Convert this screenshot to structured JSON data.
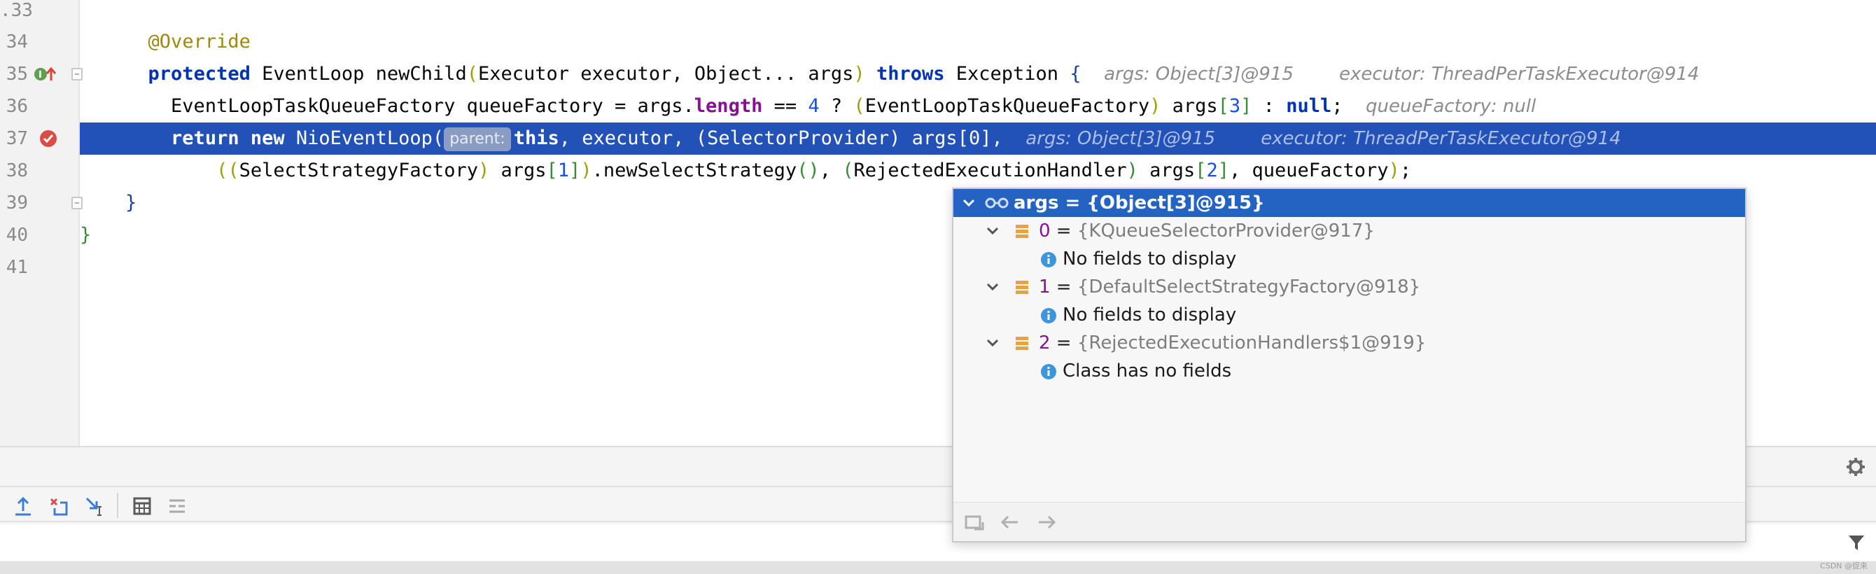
{
  "gutter": {
    "line_numbers": [
      ".33",
      "34",
      "35",
      "36",
      "37",
      "38",
      "39",
      "40",
      "41"
    ]
  },
  "code": {
    "line34": {
      "annotation": "@Override"
    },
    "line35": {
      "protected_kw": "protected",
      "ret_type": " EventLoop newChild",
      "lp": "(",
      "params_a": "Executor executor, Object... args",
      "rp": ")",
      "space": " ",
      "throws_kw": "throws",
      "rest": " Exception ",
      "brace": "{",
      "hint1": "args: Object[3]@915",
      "hint2": "executor: ThreadPerTaskExecutor@914"
    },
    "line36": {
      "a": "EventLoopTaskQueueFactory queueFactory = args.",
      "field": "length",
      "b": " == ",
      "num": "4",
      "c": " ? ",
      "lp": "(",
      "d": "EventLoopTaskQueueFactory",
      "rp": ")",
      "e": " args",
      "lb": "[",
      "idx": "3",
      "rb": "]",
      "f": " : ",
      "null_kw": "null",
      "g": ";",
      "hint": "queueFactory: null"
    },
    "line37": {
      "return_kw": "return new",
      "call": " NioEventLoop(",
      "param_badge": "parent:",
      "this_kw": "this",
      "rest": ", executor, (SelectorProvider) args[0],",
      "hint1": "args: Object[3]@915",
      "hint2": "executor: ThreadPerTaskExecutor@914"
    },
    "line38": {
      "lpp": "((",
      "a": "SelectStrategyFactory",
      "rp1": ")",
      "b": " args",
      "lb1": "[",
      "idx1": "1",
      "rb1": "]",
      "rp2": ")",
      "c": ".newSelectStrategy",
      "call_parens": "()",
      "d": ", ",
      "lp3": "(",
      "e": "RejectedExecutionHandler",
      "rp3": ")",
      "f": " args",
      "lb2": "[",
      "idx2": "2",
      "rb2": "]",
      "g": ", queueFactory",
      "rp4": ")",
      "h": ";"
    },
    "line39": {
      "brace": "}"
    },
    "line40": {
      "brace": "}"
    }
  },
  "popup": {
    "root": {
      "label": "args = {Object[3]@915}"
    },
    "items": [
      {
        "index": "0",
        "eq": " = ",
        "value": "{KQueueSelectorProvider@917}",
        "child": "No fields to display"
      },
      {
        "index": "1",
        "eq": " = ",
        "value": "{DefaultSelectStrategyFactory@918}",
        "child": "No fields to display"
      },
      {
        "index": "2",
        "eq": " = ",
        "value": "{RejectedExecutionHandlers$1@919}",
        "child": "Class has no fields"
      }
    ]
  },
  "toolbar": {
    "icons": [
      "step-out-icon",
      "drop-frame-icon",
      "run-to-cursor-icon",
      "evaluate-icon",
      "trace-icon"
    ]
  },
  "watermark": "CSDN @捉来",
  "colors": {
    "highlight_line": "#2251b7",
    "popup_selection": "#2463c2",
    "keyword": "#0033b3",
    "annotation": "#9e880d",
    "number": "#1750eb",
    "field": "#871094"
  }
}
